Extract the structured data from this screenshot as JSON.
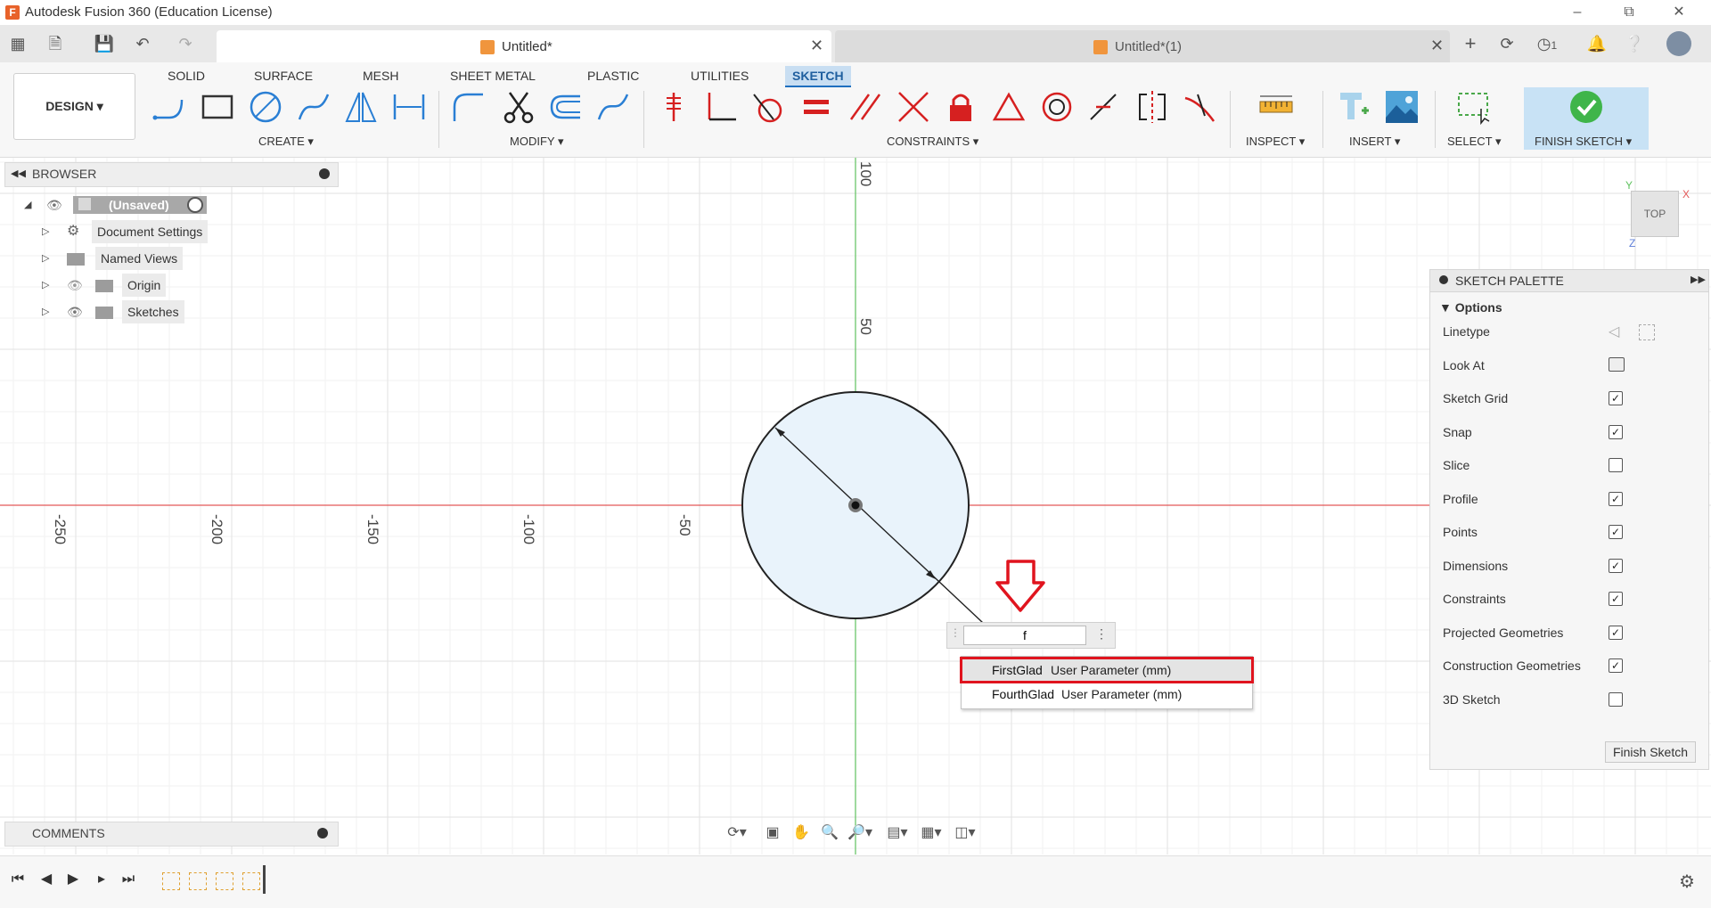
{
  "window": {
    "title": "Autodesk Fusion 360 (Education License)"
  },
  "tabs": [
    {
      "label": "Untitled*",
      "active": true
    },
    {
      "label": "Untitled*(1)",
      "active": false
    }
  ],
  "tabbar": {
    "job_count": "1"
  },
  "toolbar": {
    "workspace": "DESIGN",
    "ribbon_tabs": [
      "SOLID",
      "SURFACE",
      "MESH",
      "SHEET METAL",
      "PLASTIC",
      "UTILITIES",
      "SKETCH"
    ],
    "groups": {
      "create": "CREATE",
      "modify": "MODIFY",
      "constraints": "CONSTRAINTS",
      "inspect": "INSPECT",
      "insert": "INSERT",
      "select": "SELECT",
      "finish": "FINISH SKETCH"
    },
    "accent": "#1f6fbf"
  },
  "browser": {
    "title": "BROWSER",
    "root": "(Unsaved)",
    "items": [
      {
        "label": "Document Settings",
        "icon": "gear-icon"
      },
      {
        "label": "Named Views",
        "icon": "folder-icon"
      },
      {
        "label": "Origin",
        "icon": "folder-icon"
      },
      {
        "label": "Sketches",
        "icon": "folder-icon"
      }
    ]
  },
  "comments": {
    "title": "COMMENTS"
  },
  "canvas": {
    "axis_labels_x": [
      "-250",
      "-200",
      "-150",
      "-100",
      "-50"
    ],
    "axis_labels_y": [
      "100",
      "50"
    ],
    "viewcube": "TOP",
    "axis_x_color": "#e35757",
    "axis_y_color": "#5fc25f",
    "axis_letters": {
      "x": "X",
      "y": "Y",
      "z": "Z"
    }
  },
  "dimension": {
    "input_value": "f",
    "suggestions": [
      {
        "name": "FirstGlad",
        "type": "User Parameter (mm)",
        "highlighted": true
      },
      {
        "name": "FourthGlad",
        "type": "User Parameter (mm)",
        "highlighted": false
      }
    ],
    "highlight_color": "#e0141e"
  },
  "palette": {
    "title": "SKETCH PALETTE",
    "section": "Options",
    "options": [
      {
        "label": "Linetype",
        "kind": "icons"
      },
      {
        "label": "Look At",
        "kind": "button"
      },
      {
        "label": "Sketch Grid",
        "checked": true
      },
      {
        "label": "Snap",
        "checked": true
      },
      {
        "label": "Slice",
        "checked": false
      },
      {
        "label": "Profile",
        "checked": true
      },
      {
        "label": "Points",
        "checked": true
      },
      {
        "label": "Dimensions",
        "checked": true
      },
      {
        "label": "Constraints",
        "checked": true
      },
      {
        "label": "Projected Geometries",
        "checked": true
      },
      {
        "label": "Construction Geometries",
        "checked": true
      },
      {
        "label": "3D Sketch",
        "checked": false
      }
    ],
    "finish_label": "Finish Sketch"
  }
}
